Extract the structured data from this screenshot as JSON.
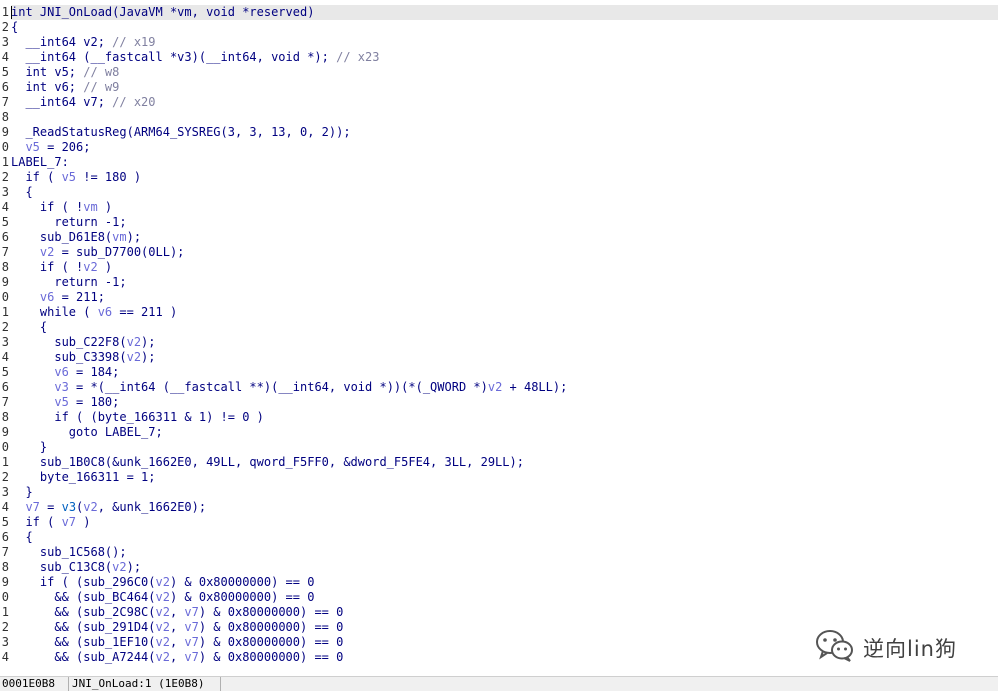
{
  "editor": {
    "lines": [
      {
        "no": "1",
        "tokens": [
          {
            "t": "int JNI_OnLoad(JavaVM *vm, void *reserved)",
            "c": "n"
          }
        ]
      },
      {
        "no": "2",
        "tokens": [
          {
            "t": "{",
            "c": "n"
          }
        ]
      },
      {
        "no": "3",
        "tokens": [
          {
            "t": "  __int64 v2; ",
            "c": "n"
          },
          {
            "t": "// x19",
            "c": "c"
          }
        ]
      },
      {
        "no": "4",
        "tokens": [
          {
            "t": "  __int64 (__fastcall *v3)(__int64, void *); ",
            "c": "n"
          },
          {
            "t": "// x23",
            "c": "c"
          }
        ]
      },
      {
        "no": "5",
        "tokens": [
          {
            "t": "  int v5; ",
            "c": "n"
          },
          {
            "t": "// w8",
            "c": "c"
          }
        ]
      },
      {
        "no": "6",
        "tokens": [
          {
            "t": "  int v6; ",
            "c": "n"
          },
          {
            "t": "// w9",
            "c": "c"
          }
        ]
      },
      {
        "no": "7",
        "tokens": [
          {
            "t": "  __int64 v7; ",
            "c": "n"
          },
          {
            "t": "// x20",
            "c": "c"
          }
        ]
      },
      {
        "no": "8",
        "tokens": [
          {
            "t": "",
            "c": "n"
          }
        ]
      },
      {
        "no": "9",
        "tokens": [
          {
            "t": "  _ReadStatusReg(ARM64_SYSREG(3, 3, 13, 0, 2));",
            "c": "n"
          }
        ]
      },
      {
        "no": "0",
        "tokens": [
          {
            "t": "  ",
            "c": "n"
          },
          {
            "t": "v5",
            "c": "v"
          },
          {
            "t": " = 206;",
            "c": "n"
          }
        ]
      },
      {
        "no": "1",
        "tokens": [
          {
            "t": "LABEL_7:",
            "c": "n"
          }
        ]
      },
      {
        "no": "2",
        "tokens": [
          {
            "t": "  if ( ",
            "c": "n"
          },
          {
            "t": "v5",
            "c": "v"
          },
          {
            "t": " != 180 )",
            "c": "n"
          }
        ]
      },
      {
        "no": "3",
        "tokens": [
          {
            "t": "  {",
            "c": "n"
          }
        ]
      },
      {
        "no": "4",
        "tokens": [
          {
            "t": "    if ( !",
            "c": "n"
          },
          {
            "t": "vm",
            "c": "v"
          },
          {
            "t": " )",
            "c": "n"
          }
        ]
      },
      {
        "no": "5",
        "tokens": [
          {
            "t": "      return -1;",
            "c": "n"
          }
        ]
      },
      {
        "no": "6",
        "tokens": [
          {
            "t": "    sub_D61E8(",
            "c": "n"
          },
          {
            "t": "vm",
            "c": "v"
          },
          {
            "t": ");",
            "c": "n"
          }
        ]
      },
      {
        "no": "7",
        "tokens": [
          {
            "t": "    ",
            "c": "n"
          },
          {
            "t": "v2",
            "c": "v"
          },
          {
            "t": " = sub_D7700(0LL);",
            "c": "n"
          }
        ]
      },
      {
        "no": "8",
        "tokens": [
          {
            "t": "    if ( !",
            "c": "n"
          },
          {
            "t": "v2",
            "c": "v"
          },
          {
            "t": " )",
            "c": "n"
          }
        ]
      },
      {
        "no": "9",
        "tokens": [
          {
            "t": "      return -1;",
            "c": "n"
          }
        ]
      },
      {
        "no": "0",
        "tokens": [
          {
            "t": "    ",
            "c": "n"
          },
          {
            "t": "v6",
            "c": "v"
          },
          {
            "t": " = 211;",
            "c": "n"
          }
        ]
      },
      {
        "no": "1",
        "tokens": [
          {
            "t": "    while ( ",
            "c": "n"
          },
          {
            "t": "v6",
            "c": "v"
          },
          {
            "t": " == 211 )",
            "c": "n"
          }
        ]
      },
      {
        "no": "2",
        "tokens": [
          {
            "t": "    {",
            "c": "n"
          }
        ]
      },
      {
        "no": "3",
        "tokens": [
          {
            "t": "      sub_C22F8(",
            "c": "n"
          },
          {
            "t": "v2",
            "c": "v"
          },
          {
            "t": ");",
            "c": "n"
          }
        ]
      },
      {
        "no": "4",
        "tokens": [
          {
            "t": "      sub_C3398(",
            "c": "n"
          },
          {
            "t": "v2",
            "c": "v"
          },
          {
            "t": ");",
            "c": "n"
          }
        ]
      },
      {
        "no": "5",
        "tokens": [
          {
            "t": "      ",
            "c": "n"
          },
          {
            "t": "v6",
            "c": "v"
          },
          {
            "t": " = 184;",
            "c": "n"
          }
        ]
      },
      {
        "no": "6",
        "tokens": [
          {
            "t": "      ",
            "c": "n"
          },
          {
            "t": "v3",
            "c": "v"
          },
          {
            "t": " = *(__int64 (__fastcall **)(__int64, void *))(*(_QWORD *)",
            "c": "n"
          },
          {
            "t": "v2",
            "c": "v"
          },
          {
            "t": " + 48LL);",
            "c": "n"
          }
        ]
      },
      {
        "no": "7",
        "tokens": [
          {
            "t": "      ",
            "c": "n"
          },
          {
            "t": "v5",
            "c": "v"
          },
          {
            "t": " = 180;",
            "c": "n"
          }
        ]
      },
      {
        "no": "8",
        "tokens": [
          {
            "t": "      if ( (byte_166311 & 1) != 0 )",
            "c": "n"
          }
        ]
      },
      {
        "no": "9",
        "tokens": [
          {
            "t": "        goto LABEL_7;",
            "c": "n"
          }
        ]
      },
      {
        "no": "0",
        "tokens": [
          {
            "t": "    }",
            "c": "n"
          }
        ]
      },
      {
        "no": "1",
        "tokens": [
          {
            "t": "    sub_1B0C8(&unk_1662E0, 49LL, qword_F5FF0, &dword_F5FE4, 3LL, 29LL);",
            "c": "n"
          }
        ]
      },
      {
        "no": "2",
        "tokens": [
          {
            "t": "    byte_166311 = 1;",
            "c": "n"
          }
        ]
      },
      {
        "no": "3",
        "tokens": [
          {
            "t": "  }",
            "c": "n"
          }
        ]
      },
      {
        "no": "4",
        "tokens": [
          {
            "t": "  ",
            "c": "n"
          },
          {
            "t": "v7",
            "c": "v"
          },
          {
            "t": " = ",
            "c": "n"
          },
          {
            "t": "v3",
            "c": "r"
          },
          {
            "t": "(",
            "c": "n"
          },
          {
            "t": "v2",
            "c": "v"
          },
          {
            "t": ", &unk_1662E0);",
            "c": "n"
          }
        ]
      },
      {
        "no": "5",
        "tokens": [
          {
            "t": "  if ( ",
            "c": "n"
          },
          {
            "t": "v7",
            "c": "v"
          },
          {
            "t": " )",
            "c": "n"
          }
        ]
      },
      {
        "no": "6",
        "tokens": [
          {
            "t": "  {",
            "c": "n"
          }
        ]
      },
      {
        "no": "7",
        "tokens": [
          {
            "t": "    sub_1C568();",
            "c": "n"
          }
        ]
      },
      {
        "no": "8",
        "tokens": [
          {
            "t": "    sub_C13C8(",
            "c": "n"
          },
          {
            "t": "v2",
            "c": "v"
          },
          {
            "t": ");",
            "c": "n"
          }
        ]
      },
      {
        "no": "9",
        "tokens": [
          {
            "t": "    if ( (sub_296C0(",
            "c": "n"
          },
          {
            "t": "v2",
            "c": "v"
          },
          {
            "t": ") & 0x80000000) == 0",
            "c": "n"
          }
        ]
      },
      {
        "no": "0",
        "tokens": [
          {
            "t": "      && (sub_BC464(",
            "c": "n"
          },
          {
            "t": "v2",
            "c": "v"
          },
          {
            "t": ") & 0x80000000) == 0",
            "c": "n"
          }
        ]
      },
      {
        "no": "1",
        "tokens": [
          {
            "t": "      && (sub_2C98C(",
            "c": "n"
          },
          {
            "t": "v2",
            "c": "v"
          },
          {
            "t": ", ",
            "c": "n"
          },
          {
            "t": "v7",
            "c": "v"
          },
          {
            "t": ") & 0x80000000) == 0",
            "c": "n"
          }
        ]
      },
      {
        "no": "2",
        "tokens": [
          {
            "t": "      && (sub_291D4(",
            "c": "n"
          },
          {
            "t": "v2",
            "c": "v"
          },
          {
            "t": ", ",
            "c": "n"
          },
          {
            "t": "v7",
            "c": "v"
          },
          {
            "t": ") & 0x80000000) == 0",
            "c": "n"
          }
        ]
      },
      {
        "no": "3",
        "tokens": [
          {
            "t": "      && (sub_1EF10(",
            "c": "n"
          },
          {
            "t": "v2",
            "c": "v"
          },
          {
            "t": ", ",
            "c": "n"
          },
          {
            "t": "v7",
            "c": "v"
          },
          {
            "t": ") & 0x80000000) == 0",
            "c": "n"
          }
        ]
      },
      {
        "no": "4",
        "tokens": [
          {
            "t": "      && (sub_A7244(",
            "c": "n"
          },
          {
            "t": "v2",
            "c": "v"
          },
          {
            "t": ", ",
            "c": "n"
          },
          {
            "t": "v7",
            "c": "v"
          },
          {
            "t": ") & 0x80000000) == 0",
            "c": "n"
          }
        ]
      }
    ]
  },
  "statusbar": {
    "address": "0001E0B8",
    "location": "JNI_OnLoad:1 (1E0B8)"
  },
  "watermark": {
    "icon": "wechat-icon",
    "text": "逆向lin狗"
  },
  "colors": {
    "code_text": "#000080",
    "comment": "#8080a0",
    "variable": "#6a6ad8",
    "call_var": "#0060c0",
    "current_line_bg": "#e8e8e8",
    "status_bg": "#f0f0f0"
  }
}
